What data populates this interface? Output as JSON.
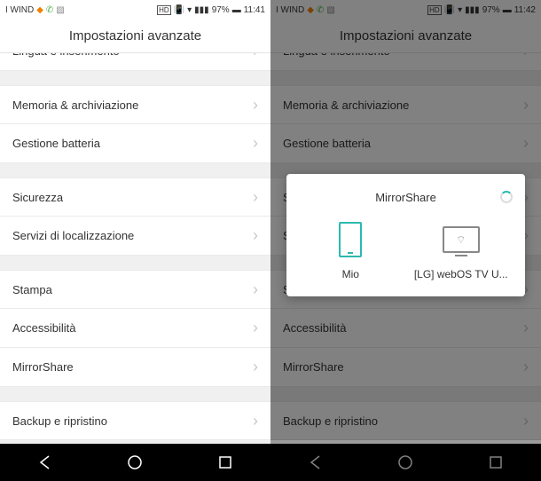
{
  "left": {
    "status": {
      "carrier": "I WIND",
      "battery": "97%",
      "time": "11:41"
    },
    "header": "Impostazioni avanzate",
    "rows": {
      "lang": "Lingua e inserimento",
      "storage": "Memoria & archiviazione",
      "battery": "Gestione batteria",
      "security": "Sicurezza",
      "location": "Servizi di localizzazione",
      "print": "Stampa",
      "accessibility": "Accessibilità",
      "mirror": "MirrorShare",
      "backup": "Backup e ripristino"
    }
  },
  "right": {
    "status": {
      "carrier": "I WIND",
      "battery": "97%",
      "time": "11:42"
    },
    "header": "Impostazioni avanzate",
    "rows": {
      "lang": "Lingua e inserimento",
      "storage": "Memoria & archiviazione",
      "battery": "Gestione batteria",
      "security": "Sicurezza",
      "location": "Servizi di localizzazione",
      "print": "Stampa",
      "accessibility": "Accessibilità",
      "mirror": "MirrorShare",
      "backup": "Backup e ripristino"
    },
    "modal": {
      "title": "MirrorShare",
      "device1": "Mio",
      "device2": "[LG] webOS TV U..."
    }
  }
}
